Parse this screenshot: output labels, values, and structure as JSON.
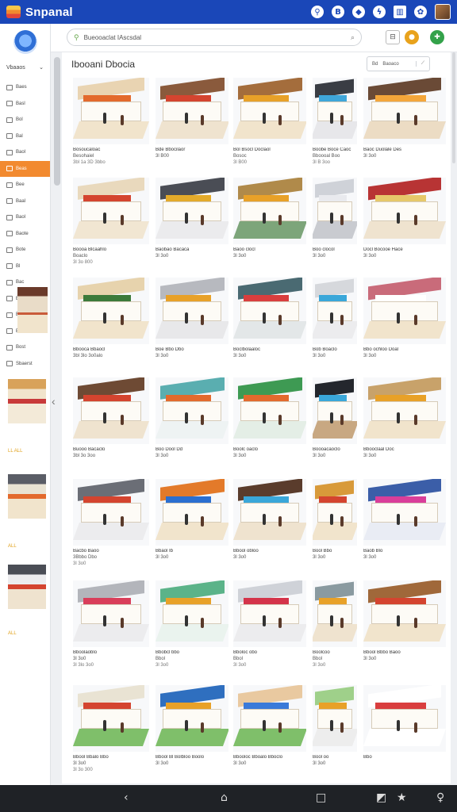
{
  "app": {
    "title": "Snpanal"
  },
  "topbar": {
    "icons": [
      {
        "name": "support-icon",
        "glyph": "⚲",
        "shape": "round"
      },
      {
        "name": "notifications-icon",
        "glyph": "B",
        "shape": "round",
        "badge": "1"
      },
      {
        "name": "shield-icon",
        "glyph": "◆",
        "shape": "round"
      },
      {
        "name": "bolt-icon",
        "glyph": "ϟ",
        "shape": "round"
      },
      {
        "name": "columns-icon",
        "glyph": "▥",
        "shape": "sq"
      },
      {
        "name": "settings-icon",
        "glyph": "✿",
        "shape": "round"
      }
    ]
  },
  "sidebar": {
    "workspace": "Vbaaos",
    "items": [
      {
        "label": "Baes",
        "active": false
      },
      {
        "label": "Basl",
        "active": false
      },
      {
        "label": "Bol",
        "active": false
      },
      {
        "label": "Bal",
        "active": false
      },
      {
        "label": "Baol",
        "active": false
      },
      {
        "label": "Beas",
        "active": true
      },
      {
        "label": "Bee",
        "active": false
      },
      {
        "label": "Baal",
        "active": false
      },
      {
        "label": "Baol",
        "active": false
      },
      {
        "label": "Baote",
        "active": false
      },
      {
        "label": "Bote",
        "active": false
      },
      {
        "label": "Bl",
        "active": false
      },
      {
        "label": "Bac",
        "active": false
      },
      {
        "label": "Baote",
        "active": false
      },
      {
        "label": "Bl",
        "active": false
      },
      {
        "label": "Bos",
        "active": false
      },
      {
        "label": "Bost",
        "active": false
      },
      {
        "label": "Sbaerst",
        "active": false
      }
    ],
    "thumb_captions": [
      "LL ALL",
      "ALL",
      "ALL"
    ]
  },
  "search": {
    "value": "Bueooaclat IAscsdal"
  },
  "header_buttons": [
    {
      "name": "tray-button",
      "glyph": "⊟",
      "color": "#ffffff"
    },
    {
      "name": "coin-button",
      "glyph": "●",
      "color": "#e8a21c"
    },
    {
      "name": "add-button",
      "glyph": "✚",
      "color": "#33a24a"
    }
  ],
  "main": {
    "heading": "Ibooani Dbocia",
    "filter": {
      "label1": "Bd",
      "label2": "Baoaco"
    }
  },
  "colors": {
    "accent": "#f28a2f",
    "brand": "#1a47b8"
  },
  "cards": [
    {
      "l1": "Bosoucaloac",
      "l2": "Besohaiel",
      "l3": "3bl 1a 3D 3bbo",
      "roof": "#e9d4b2",
      "sign": "#e36a2d",
      "floor": "#f1e4cc"
    },
    {
      "l1": "Bde Bbocilaor",
      "l2": "3l B00",
      "l3": "",
      "roof": "#8a5a3c",
      "sign": "#d4442f",
      "floor": "#efe3cf"
    },
    {
      "l1": "Bol Bsocl Doclaol",
      "l2": "Bosoc",
      "l3": "3l B00",
      "roof": "#a46d3c",
      "sign": "#e8a128",
      "floor": "#f1e4cc"
    },
    {
      "l1": "Boobe Boce Caoc",
      "l2": "Bboooal Boo",
      "l3": "3l B 3oo",
      "roof": "#3a3d44",
      "sign": "#3fa6d9",
      "floor": "#e7e7ea"
    },
    {
      "l1": "Baoc Duolale Des",
      "l2": "3l 3o0",
      "l3": "",
      "roof": "#6a4a36",
      "sign": "#f4a63a",
      "floor": "#ecdcc4"
    },
    {
      "l1": "Boooa Blcaahlo",
      "l2": "Boaclo",
      "l3": "3l 3o 800",
      "roof": "#e9d9bd",
      "sign": "#d4442f",
      "floor": "#f1e6d2"
    },
    {
      "l1": "Baobao Bacaca",
      "l2": "3l 3o0",
      "l3": "",
      "roof": "#4a4d55",
      "sign": "#e3aa2a",
      "floor": "#ebebed"
    },
    {
      "l1": "Baoo clocl",
      "l2": "3l 3o0",
      "l3": "",
      "roof": "#b08a4a",
      "sign": "#e8a128",
      "floor": "#7da57a"
    },
    {
      "l1": "Boo clocol",
      "l2": "3l 3o0",
      "l3": "",
      "roof": "#cfd2d8",
      "sign": "#e9eaee",
      "floor": "#c9cbd0"
    },
    {
      "l1": "Docl Bocooe Hace",
      "l2": "3l 3o0",
      "l3": "",
      "roof": "#b83434",
      "sign": "#e6c86a",
      "floor": "#efe3cf"
    },
    {
      "l1": "Bbooca Bbaocl",
      "l2": "3bl 3lo 3o0alo",
      "l3": "",
      "roof": "#e7d3ad",
      "sign": "#3c7a3a",
      "floor": "#f1e4cc"
    },
    {
      "l1": "Boe Bbo Dbo",
      "l2": "3l 3o0",
      "l3": "",
      "roof": "#b7b9bf",
      "sign": "#e8a128",
      "floor": "#e8e8ea"
    },
    {
      "l1": "Boclbolaaloc",
      "l2": "3l 3o0",
      "l3": "",
      "roof": "#4a6a72",
      "sign": "#d93e3e",
      "floor": "#e3e7e8"
    },
    {
      "l1": "Bob Boaclo",
      "l2": "3l 3o0",
      "l3": "",
      "roof": "#d6d8dc",
      "sign": "#3aa7d9",
      "floor": "#ececee"
    },
    {
      "l1": "Bbo ochloo Doal",
      "l2": "3l 3o0",
      "l3": "",
      "roof": "#c96b7a",
      "sign": "#ffffff",
      "floor": "#f1e4cc"
    },
    {
      "l1": "Buooo Bacaclo",
      "l2": "3bl 3o 3oo",
      "l3": "",
      "roof": "#6e4a34",
      "sign": "#d4442f",
      "floor": "#efe3cf"
    },
    {
      "l1": "Boo Dool Dd",
      "l2": "3l 3o0",
      "l3": "",
      "roof": "#5aaeb0",
      "sign": "#e36a2d",
      "floor": "#eef3f3"
    },
    {
      "l1": "Boolc oaclo",
      "l2": "3l 3o0",
      "l3": "",
      "roof": "#3e9a53",
      "sign": "#e36a2d",
      "floor": "#e4eee6"
    },
    {
      "l1": "Boooacaoclo",
      "l2": "3l 3o0",
      "l3": "",
      "roof": "#24272d",
      "sign": "#3aa7d9",
      "floor": "#c8a882"
    },
    {
      "l1": "Bbooclaal Doc",
      "l2": "3l 3o0",
      "l3": "",
      "roof": "#c8a26a",
      "sign": "#e8a128",
      "floor": "#f1e4cc"
    },
    {
      "l1": "Bacbo Baoo",
      "l2": "3Bbbo Dbo",
      "l3": "3l 3o0",
      "roof": "#6b6e76",
      "sign": "#d4442f",
      "floor": "#ececee"
    },
    {
      "l1": "Bbaol Ib",
      "l2": "3l 3o0",
      "l3": "",
      "roof": "#e37a2a",
      "sign": "#2b6fd0",
      "floor": "#f1e4cc"
    },
    {
      "l1": "Bbool obloo",
      "l2": "3l 3o0",
      "l3": "",
      "roof": "#5a3c2c",
      "sign": "#3aa7d9",
      "floor": "#efe3cf"
    },
    {
      "l1": "Bool Bbo",
      "l2": "3l 3o0",
      "l3": "",
      "roof": "#d89a3a",
      "sign": "#d4442f",
      "floor": "#f1e4cc"
    },
    {
      "l1": "Baob Blo",
      "l2": "3l 3o0",
      "l3": "",
      "roof": "#3b5ea8",
      "sign": "#d93e9a",
      "floor": "#e9ecf4"
    },
    {
      "l1": "Bboolaoblo",
      "l2": "3l 3o0",
      "l3": "3l 3lo 3o0",
      "roof": "#b3b5bb",
      "sign": "#d93e5a",
      "floor": "#ececee"
    },
    {
      "l1": "Bbobcl bbo",
      "l2": "Bbol",
      "l3": "3l 3o0",
      "roof": "#5bb389",
      "sign": "#e8a128",
      "floor": "#eaf3ee"
    },
    {
      "l1": "Bboloc obo",
      "l2": "Bbol",
      "l3": "3l 3o0",
      "roof": "#cfd2d8",
      "sign": "#d4344a",
      "floor": "#ececee"
    },
    {
      "l1": "Boolcoo",
      "l2": "Bbol",
      "l3": "3l 3o0",
      "roof": "#8a9aa0",
      "sign": "#e8a128",
      "floor": "#efe3cf"
    },
    {
      "l1": "Bbool Bbbo Baoo",
      "l2": "3l 3o0",
      "l3": "",
      "roof": "#a0683a",
      "sign": "#d4442f",
      "floor": "#f1e4cc"
    },
    {
      "l1": "Bbool Bbalo Bbo",
      "l2": "3l 3o0",
      "l3": "3l 3o 300",
      "roof": "#e9e3d3",
      "sign": "#d4442f",
      "floor": "#7fbf6a"
    },
    {
      "l1": "Bbool Bl Bolbloo Boolo",
      "l2": "3l 3o0",
      "l3": "",
      "roof": "#2f6fbf",
      "sign": "#e8a128",
      "floor": "#7fbf6a"
    },
    {
      "l1": "Bbooloc Bboalo Bboclo",
      "l2": "3l 3o0",
      "l3": "",
      "roof": "#e9c9a0",
      "sign": "#3a7ad9",
      "floor": "#7fbf6a"
    },
    {
      "l1": "Bool oo",
      "l2": "3l 3o0",
      "l3": "",
      "roof": "#9fd08a",
      "sign": "#e8a128",
      "floor": "#ededed"
    },
    {
      "l1": "Bbo",
      "l2": "",
      "l3": "",
      "roof": "#ffffff",
      "sign": "#d93e3e",
      "floor": "#ffffff"
    }
  ],
  "bottom_nav": [
    {
      "name": "back-icon",
      "glyph": "‹"
    },
    {
      "name": "home-icon",
      "glyph": "⌂"
    },
    {
      "name": "recents-icon",
      "glyph": "□"
    },
    {
      "name": "rotate-icon",
      "glyph": "◩"
    },
    {
      "name": "star-icon",
      "glyph": "★"
    },
    {
      "name": "user-icon",
      "glyph": "♀"
    }
  ]
}
